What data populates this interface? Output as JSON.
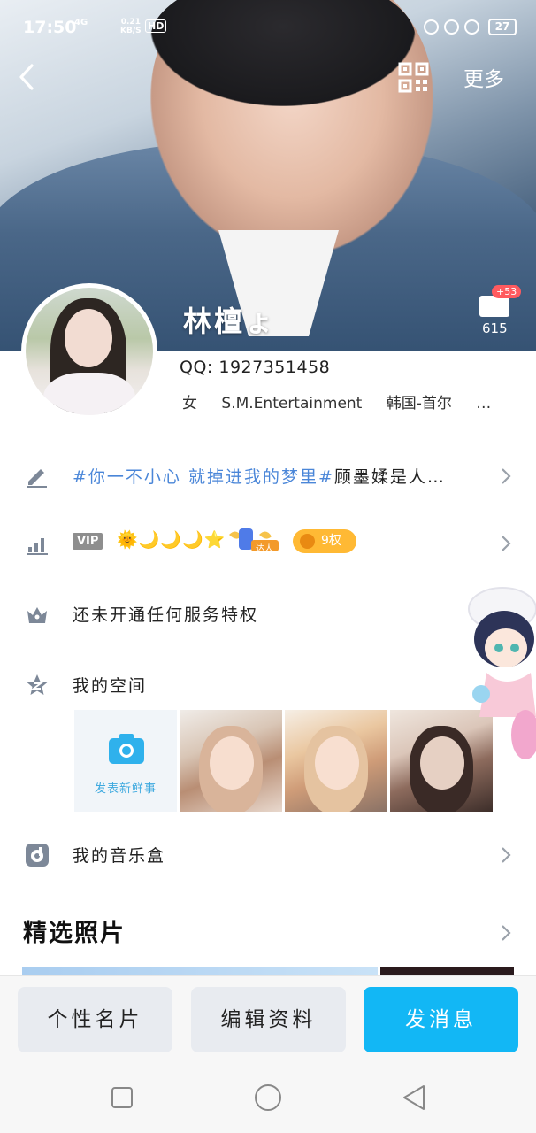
{
  "status_bar": {
    "time": "17:50",
    "network": "4G",
    "speed_value": "0.21",
    "speed_unit": "KB/S",
    "hd": "HD",
    "battery": "27"
  },
  "header": {
    "more_label": "更多",
    "nickname": "林檀ょ",
    "like_plus": "+53",
    "like_count": "615"
  },
  "profile": {
    "qq_label": "QQ:",
    "qq_number": "1927351458",
    "gender": "女",
    "company": "S.M.Entertainment",
    "location": "韩国-首尔",
    "ellipsis": "…"
  },
  "rows": {
    "signature_tag": "#你一不小心 就掉进我的梦里#",
    "signature_rest": "顾墨媃是人…",
    "vip_label": "VIP",
    "level_icons": "🌞🌙🌙🌙⭐",
    "fans_label": "达人",
    "privilege": "9权",
    "service_text": "还未开通任何服务特权",
    "space_title": "我的空间",
    "post_label": "发表新鲜事",
    "music_title": "我的音乐盒"
  },
  "photos_section": {
    "title": "精选照片"
  },
  "actions": {
    "card": "个性名片",
    "edit": "编辑资料",
    "message": "发消息"
  },
  "colors": {
    "accent": "#12b7f5",
    "signature_tag": "#4a86d8",
    "privilege_pill": "#ffb934",
    "icon_gray": "#7d8898"
  }
}
